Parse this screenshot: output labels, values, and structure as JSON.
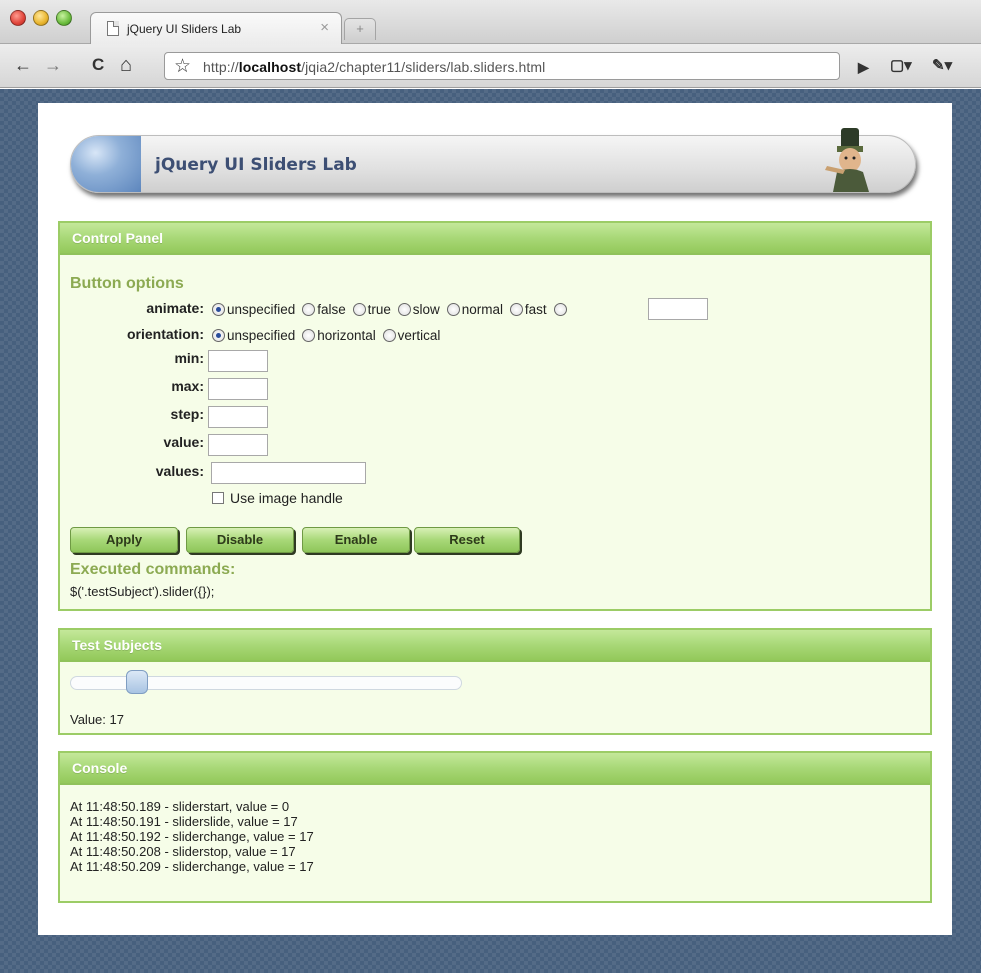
{
  "browser": {
    "tab_title": "jQuery UI Sliders Lab",
    "tab_close": "×",
    "new_tab": "+",
    "url_prefix": "http://",
    "url_host": "localhost",
    "url_path": "/jqia2/chapter11/sliders/lab.sliders.html",
    "back": "←",
    "forward": "→",
    "reload": "C",
    "home": "⌂",
    "bookmark": "☆",
    "play": "▶",
    "page_menu": "▢▾",
    "wrench_menu": "✎▾"
  },
  "banner": {
    "title": "jQuery UI Sliders Lab"
  },
  "control_panel": {
    "header": "Control Panel",
    "section_title": "Button options",
    "animate": {
      "label": "animate:",
      "options": [
        "unspecified",
        "false",
        "true",
        "slow",
        "normal",
        "fast",
        ""
      ],
      "selected": 0,
      "custom_value": ""
    },
    "orientation": {
      "label": "orientation:",
      "options": [
        "unspecified",
        "horizontal",
        "vertical"
      ],
      "selected": 0
    },
    "min": {
      "label": "min:",
      "value": ""
    },
    "max": {
      "label": "max:",
      "value": ""
    },
    "step": {
      "label": "step:",
      "value": ""
    },
    "value": {
      "label": "value:",
      "value": ""
    },
    "values": {
      "label": "values:",
      "value": ""
    },
    "image_handle": {
      "label": "Use image handle",
      "checked": false
    },
    "buttons": {
      "apply": "Apply",
      "disable": "Disable",
      "enable": "Enable",
      "reset": "Reset"
    },
    "executed_title": "Executed commands:",
    "executed_command": "$('.testSubject').slider({});"
  },
  "test_subjects": {
    "header": "Test Subjects",
    "slider_value": 17,
    "slider_min": 0,
    "slider_max": 100,
    "value_text": "Value: 17"
  },
  "console": {
    "header": "Console",
    "lines": [
      "At 11:48:50.189 - sliderstart, value = 0",
      "At 11:48:50.191 - sliderslide, value = 17",
      "At 11:48:50.192 - sliderchange, value = 17",
      "At 11:48:50.208 - sliderstop, value = 17",
      "At 11:48:50.209 - sliderchange, value = 17"
    ]
  }
}
